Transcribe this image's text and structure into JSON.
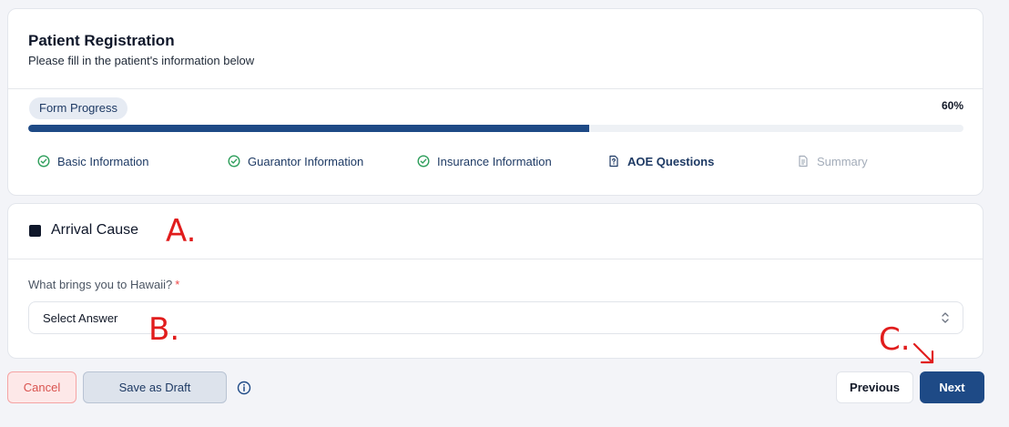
{
  "header": {
    "title": "Patient Registration",
    "subtitle": "Please fill in the patient's information below"
  },
  "progress": {
    "label": "Form Progress",
    "percent_text": "60%",
    "percent": 60,
    "fill_color": "#1e4a86"
  },
  "steps": [
    {
      "label": "Basic Information",
      "status": "complete",
      "icon": "check-circle-icon"
    },
    {
      "label": "Guarantor Information",
      "status": "complete",
      "icon": "check-circle-icon"
    },
    {
      "label": "Insurance Information",
      "status": "complete",
      "icon": "check-circle-icon"
    },
    {
      "label": "AOE Questions",
      "status": "active",
      "icon": "question-document-icon"
    },
    {
      "label": "Summary",
      "status": "pending",
      "icon": "document-icon"
    }
  ],
  "section": {
    "title": "Arrival Cause",
    "question_label": "What brings you to Hawaii?",
    "required_mark": "*",
    "select_value": "Select Answer"
  },
  "annotations": {
    "a": "A.",
    "b": "B.",
    "c": "C."
  },
  "actions": {
    "cancel": "Cancel",
    "save_draft": "Save as Draft",
    "previous": "Previous",
    "next": "Next"
  },
  "colors": {
    "primary": "#1e4a86",
    "complete_green": "#2e9e5b",
    "annotation_red": "#e11d1d"
  }
}
